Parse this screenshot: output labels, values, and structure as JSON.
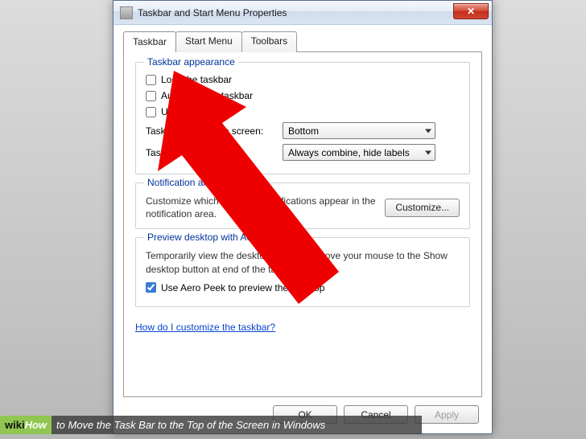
{
  "window": {
    "title": "Taskbar and Start Menu Properties",
    "close_glyph": "✕"
  },
  "tabs": [
    {
      "label": "Taskbar",
      "active": true
    },
    {
      "label": "Start Menu",
      "active": false
    },
    {
      "label": "Toolbars",
      "active": false
    }
  ],
  "appearance": {
    "legend": "Taskbar appearance",
    "lock": {
      "label": "Lock the taskbar",
      "checked": false
    },
    "autohide": {
      "label": "Auto-hide the taskbar",
      "checked": false
    },
    "smallicons": {
      "label": "Use small icons",
      "checked": false
    },
    "location": {
      "label": "Taskbar location on screen:",
      "value": "Bottom"
    },
    "buttons": {
      "label": "Taskbar buttons:",
      "value": "Always combine, hide labels"
    }
  },
  "notification": {
    "legend": "Notification area",
    "desc": "Customize which icons and notifications appear in the notification area.",
    "button": "Customize..."
  },
  "aero": {
    "legend": "Preview desktop with Aero Peek",
    "desc": "Temporarily view the desktop when you move your mouse to the Show desktop button at end of the taskbar.",
    "checkbox": {
      "label": "Use Aero Peek to preview the desktop",
      "checked": true
    }
  },
  "help_link": "How do I customize the taskbar?",
  "buttons": {
    "ok": "OK",
    "cancel": "Cancel",
    "apply": "Apply"
  },
  "caption": {
    "brand_a": "wiki",
    "brand_b": "How",
    "tail": " to Move the Task Bar to the Top of the Screen in Windows"
  }
}
